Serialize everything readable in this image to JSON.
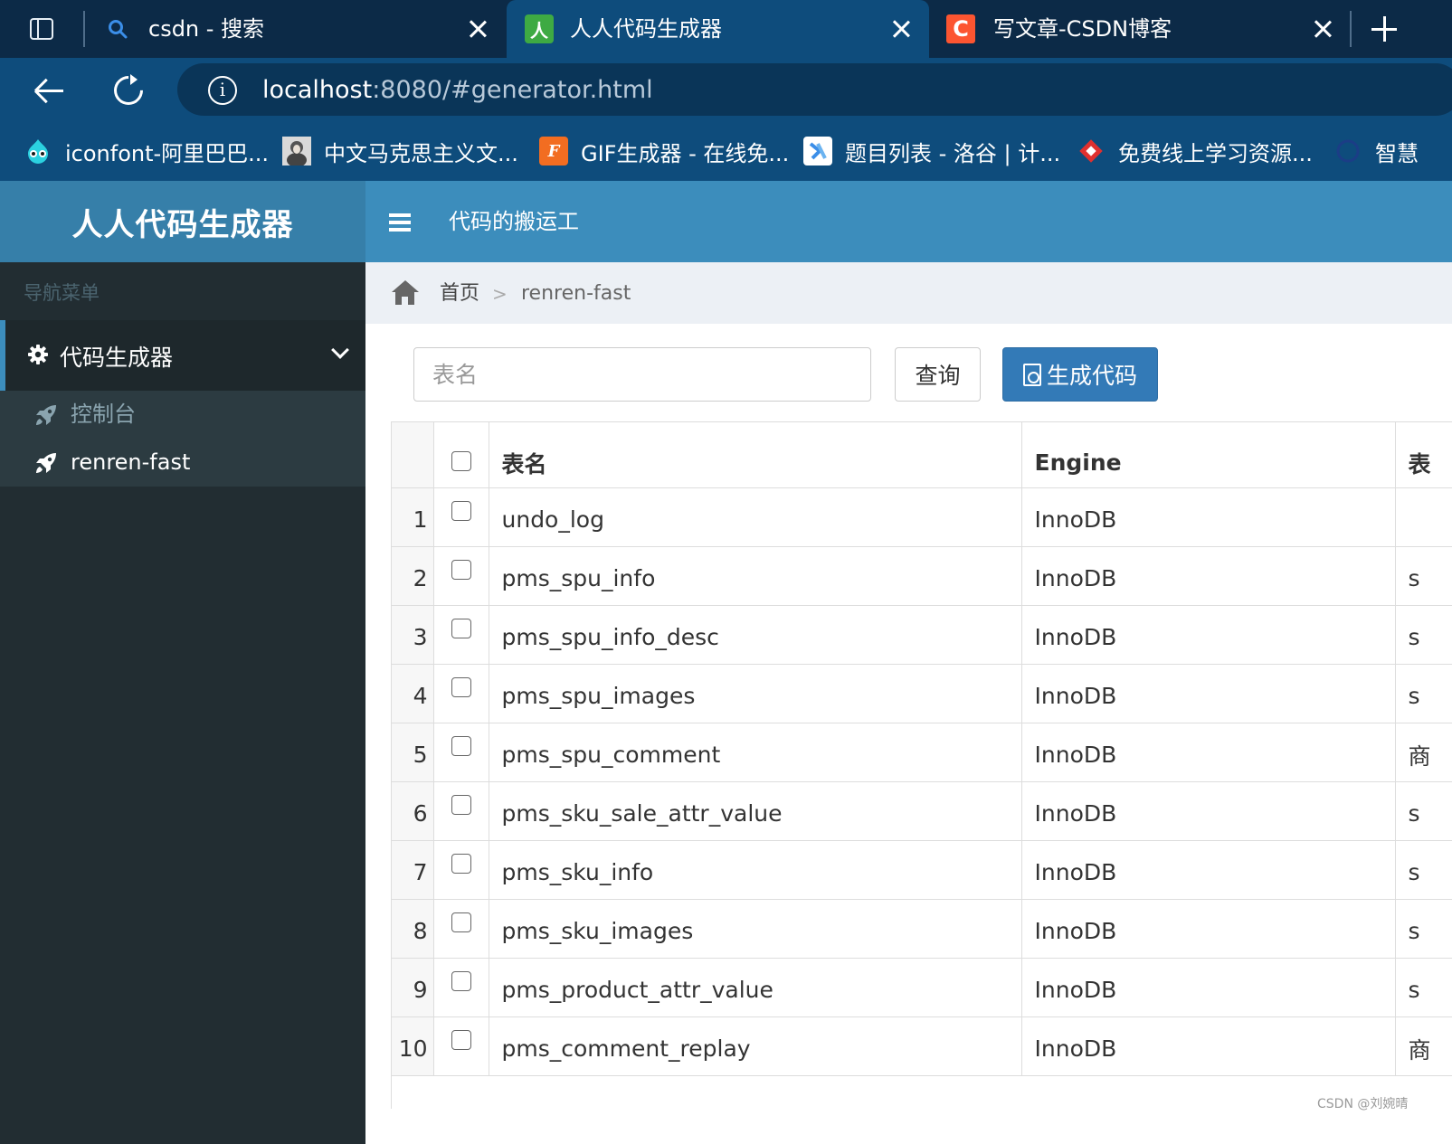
{
  "browser": {
    "tabs": [
      {
        "title": "csdn - 搜索",
        "icon": "search-icon",
        "active": false
      },
      {
        "title": "人人代码生成器",
        "icon": "renren-app-icon",
        "active": true
      },
      {
        "title": "写文章-CSDN博客",
        "icon": "csdn-icon",
        "active": false
      }
    ],
    "url": {
      "host": "localhost",
      "rest": ":8080/#generator.html"
    },
    "bookmarks": [
      {
        "label": "iconfont-阿里巴巴...",
        "icon": "iconfont-icon",
        "color": "#2bd1e0"
      },
      {
        "label": "中文马克思主义文...",
        "icon": "portrait-icon",
        "color": "#888888"
      },
      {
        "label": "GIF生成器 - 在线免...",
        "icon": "gif-f-icon",
        "color": "#f26d21"
      },
      {
        "label": "题目列表 - 洛谷 | 计...",
        "icon": "luogu-icon",
        "color": "#ffffff"
      },
      {
        "label": "免费线上学习资源...",
        "icon": "diamond-icon",
        "color": "#e0302f"
      },
      {
        "label": "智慧",
        "icon": "circle-icon",
        "color": "#1b3d86"
      }
    ]
  },
  "app": {
    "logo": "人人代码生成器",
    "navbar_title": "代码的搬运工",
    "accent": "#3c8dbc"
  },
  "sidebar": {
    "header": "导航菜单",
    "group_label": "代码生成器",
    "items": [
      {
        "label": "控制台"
      },
      {
        "label": "renren-fast"
      }
    ]
  },
  "breadcrumb": {
    "home": "首页",
    "separator": ">",
    "current": "renren-fast"
  },
  "toolbar": {
    "search_placeholder": "表名",
    "query_label": "查询",
    "generate_label": "生成代码"
  },
  "table": {
    "headers": {
      "name": "表名",
      "engine": "Engine",
      "extra": "表"
    },
    "rows": [
      {
        "n": "1",
        "name": "undo_log",
        "engine": "InnoDB",
        "extra": ""
      },
      {
        "n": "2",
        "name": "pms_spu_info",
        "engine": "InnoDB",
        "extra": "s"
      },
      {
        "n": "3",
        "name": "pms_spu_info_desc",
        "engine": "InnoDB",
        "extra": "s"
      },
      {
        "n": "4",
        "name": "pms_spu_images",
        "engine": "InnoDB",
        "extra": "s"
      },
      {
        "n": "5",
        "name": "pms_spu_comment",
        "engine": "InnoDB",
        "extra": "商"
      },
      {
        "n": "6",
        "name": "pms_sku_sale_attr_value",
        "engine": "InnoDB",
        "extra": "s"
      },
      {
        "n": "7",
        "name": "pms_sku_info",
        "engine": "InnoDB",
        "extra": "s"
      },
      {
        "n": "8",
        "name": "pms_sku_images",
        "engine": "InnoDB",
        "extra": "s"
      },
      {
        "n": "9",
        "name": "pms_product_attr_value",
        "engine": "InnoDB",
        "extra": "s"
      },
      {
        "n": "10",
        "name": "pms_comment_replay",
        "engine": "InnoDB",
        "extra": "商"
      }
    ]
  },
  "watermark": "CSDN @刘婉晴"
}
